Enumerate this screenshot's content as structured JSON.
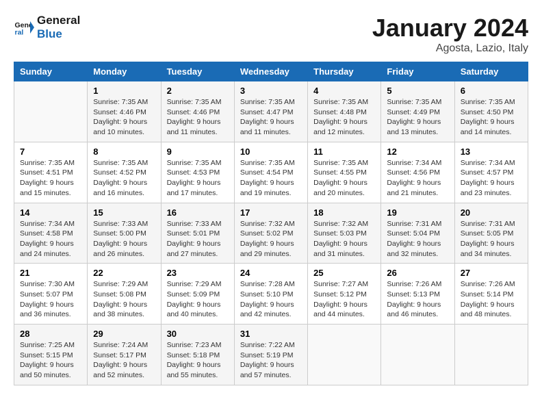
{
  "logo": {
    "line1": "General",
    "line2": "Blue"
  },
  "title": "January 2024",
  "subtitle": "Agosta, Lazio, Italy",
  "days_header": [
    "Sunday",
    "Monday",
    "Tuesday",
    "Wednesday",
    "Thursday",
    "Friday",
    "Saturday"
  ],
  "weeks": [
    [
      {
        "day": "",
        "info": ""
      },
      {
        "day": "1",
        "info": "Sunrise: 7:35 AM\nSunset: 4:46 PM\nDaylight: 9 hours\nand 10 minutes."
      },
      {
        "day": "2",
        "info": "Sunrise: 7:35 AM\nSunset: 4:46 PM\nDaylight: 9 hours\nand 11 minutes."
      },
      {
        "day": "3",
        "info": "Sunrise: 7:35 AM\nSunset: 4:47 PM\nDaylight: 9 hours\nand 11 minutes."
      },
      {
        "day": "4",
        "info": "Sunrise: 7:35 AM\nSunset: 4:48 PM\nDaylight: 9 hours\nand 12 minutes."
      },
      {
        "day": "5",
        "info": "Sunrise: 7:35 AM\nSunset: 4:49 PM\nDaylight: 9 hours\nand 13 minutes."
      },
      {
        "day": "6",
        "info": "Sunrise: 7:35 AM\nSunset: 4:50 PM\nDaylight: 9 hours\nand 14 minutes."
      }
    ],
    [
      {
        "day": "7",
        "info": "Sunrise: 7:35 AM\nSunset: 4:51 PM\nDaylight: 9 hours\nand 15 minutes."
      },
      {
        "day": "8",
        "info": "Sunrise: 7:35 AM\nSunset: 4:52 PM\nDaylight: 9 hours\nand 16 minutes."
      },
      {
        "day": "9",
        "info": "Sunrise: 7:35 AM\nSunset: 4:53 PM\nDaylight: 9 hours\nand 17 minutes."
      },
      {
        "day": "10",
        "info": "Sunrise: 7:35 AM\nSunset: 4:54 PM\nDaylight: 9 hours\nand 19 minutes."
      },
      {
        "day": "11",
        "info": "Sunrise: 7:35 AM\nSunset: 4:55 PM\nDaylight: 9 hours\nand 20 minutes."
      },
      {
        "day": "12",
        "info": "Sunrise: 7:34 AM\nSunset: 4:56 PM\nDaylight: 9 hours\nand 21 minutes."
      },
      {
        "day": "13",
        "info": "Sunrise: 7:34 AM\nSunset: 4:57 PM\nDaylight: 9 hours\nand 23 minutes."
      }
    ],
    [
      {
        "day": "14",
        "info": "Sunrise: 7:34 AM\nSunset: 4:58 PM\nDaylight: 9 hours\nand 24 minutes."
      },
      {
        "day": "15",
        "info": "Sunrise: 7:33 AM\nSunset: 5:00 PM\nDaylight: 9 hours\nand 26 minutes."
      },
      {
        "day": "16",
        "info": "Sunrise: 7:33 AM\nSunset: 5:01 PM\nDaylight: 9 hours\nand 27 minutes."
      },
      {
        "day": "17",
        "info": "Sunrise: 7:32 AM\nSunset: 5:02 PM\nDaylight: 9 hours\nand 29 minutes."
      },
      {
        "day": "18",
        "info": "Sunrise: 7:32 AM\nSunset: 5:03 PM\nDaylight: 9 hours\nand 31 minutes."
      },
      {
        "day": "19",
        "info": "Sunrise: 7:31 AM\nSunset: 5:04 PM\nDaylight: 9 hours\nand 32 minutes."
      },
      {
        "day": "20",
        "info": "Sunrise: 7:31 AM\nSunset: 5:05 PM\nDaylight: 9 hours\nand 34 minutes."
      }
    ],
    [
      {
        "day": "21",
        "info": "Sunrise: 7:30 AM\nSunset: 5:07 PM\nDaylight: 9 hours\nand 36 minutes."
      },
      {
        "day": "22",
        "info": "Sunrise: 7:29 AM\nSunset: 5:08 PM\nDaylight: 9 hours\nand 38 minutes."
      },
      {
        "day": "23",
        "info": "Sunrise: 7:29 AM\nSunset: 5:09 PM\nDaylight: 9 hours\nand 40 minutes."
      },
      {
        "day": "24",
        "info": "Sunrise: 7:28 AM\nSunset: 5:10 PM\nDaylight: 9 hours\nand 42 minutes."
      },
      {
        "day": "25",
        "info": "Sunrise: 7:27 AM\nSunset: 5:12 PM\nDaylight: 9 hours\nand 44 minutes."
      },
      {
        "day": "26",
        "info": "Sunrise: 7:26 AM\nSunset: 5:13 PM\nDaylight: 9 hours\nand 46 minutes."
      },
      {
        "day": "27",
        "info": "Sunrise: 7:26 AM\nSunset: 5:14 PM\nDaylight: 9 hours\nand 48 minutes."
      }
    ],
    [
      {
        "day": "28",
        "info": "Sunrise: 7:25 AM\nSunset: 5:15 PM\nDaylight: 9 hours\nand 50 minutes."
      },
      {
        "day": "29",
        "info": "Sunrise: 7:24 AM\nSunset: 5:17 PM\nDaylight: 9 hours\nand 52 minutes."
      },
      {
        "day": "30",
        "info": "Sunrise: 7:23 AM\nSunset: 5:18 PM\nDaylight: 9 hours\nand 55 minutes."
      },
      {
        "day": "31",
        "info": "Sunrise: 7:22 AM\nSunset: 5:19 PM\nDaylight: 9 hours\nand 57 minutes."
      },
      {
        "day": "",
        "info": ""
      },
      {
        "day": "",
        "info": ""
      },
      {
        "day": "",
        "info": ""
      }
    ]
  ]
}
